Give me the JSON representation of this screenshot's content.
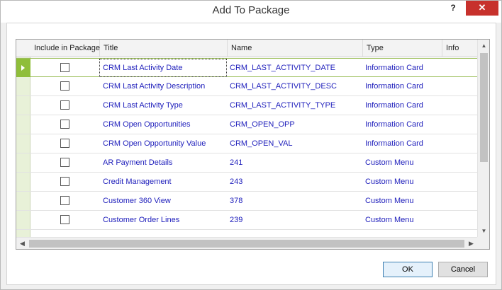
{
  "window": {
    "title": "Add To Package",
    "help_label": "?",
    "close_label": "✕"
  },
  "grid": {
    "columns": {
      "include": "Include in Package",
      "title": "Title",
      "name": "Name",
      "type": "Type",
      "info": "Info"
    },
    "rows": [
      {
        "included": false,
        "title": "CRM Last Activity Date",
        "name": "CRM_LAST_ACTIVITY_DATE",
        "type": "Information Card",
        "info": ""
      },
      {
        "included": false,
        "title": "CRM Last Activity Description",
        "name": "CRM_LAST_ACTIVITY_DESC",
        "type": "Information Card",
        "info": ""
      },
      {
        "included": false,
        "title": "CRM Last Activity Type",
        "name": "CRM_LAST_ACTIVITY_TYPE",
        "type": "Information Card",
        "info": ""
      },
      {
        "included": false,
        "title": "CRM Open Opportunities",
        "name": "CRM_OPEN_OPP",
        "type": "Information Card",
        "info": ""
      },
      {
        "included": false,
        "title": "CRM Open Opportunity Value",
        "name": "CRM_OPEN_VAL",
        "type": "Information Card",
        "info": ""
      },
      {
        "included": false,
        "title": "AR Payment Details",
        "name": "241",
        "type": "Custom Menu",
        "info": ""
      },
      {
        "included": false,
        "title": "Credit Management",
        "name": "243",
        "type": "Custom Menu",
        "info": ""
      },
      {
        "included": false,
        "title": "Customer 360 View",
        "name": "378",
        "type": "Custom Menu",
        "info": ""
      },
      {
        "included": false,
        "title": "Customer Order Lines",
        "name": "239",
        "type": "Custom Menu",
        "info": ""
      }
    ],
    "selected_row": 0
  },
  "buttons": {
    "ok": "OK",
    "cancel": "Cancel"
  },
  "icons": {
    "row_selected": "play-arrow-icon",
    "scroll_up": "chevron-up-icon",
    "scroll_down": "chevron-down-icon",
    "scroll_left": "chevron-left-icon",
    "scroll_right": "chevron-right-icon"
  },
  "colors": {
    "selection_marker": "#8fbe3a",
    "row_header_bg": "#e8f1d8",
    "link_text": "#1d1dbb",
    "close_button": "#c7312c"
  }
}
